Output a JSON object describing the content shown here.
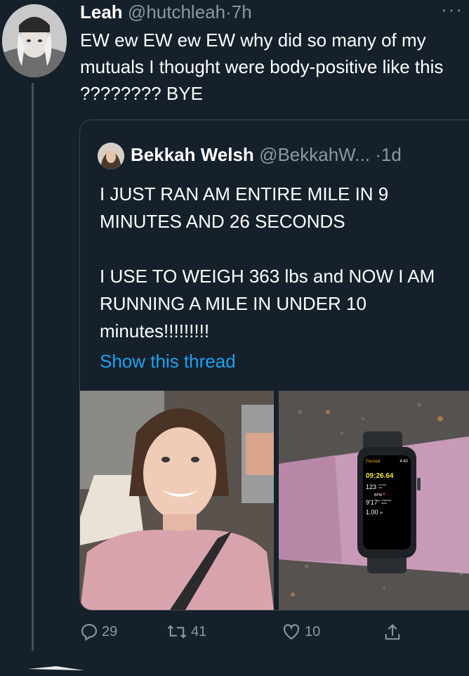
{
  "tweet": {
    "author_name": "Leah",
    "handle": "@hutchleah",
    "separator": "·",
    "time": "7h",
    "text": "EW ew EW ew EW why did so many of my mutuals I thought were body-positive like this ???????? BYE"
  },
  "quote": {
    "author_name": "Bekkah Welsh",
    "handle": "@BekkahW...",
    "separator": "·",
    "time": "1d",
    "text": "I JUST RAN AM ENTIRE MILE IN 9 MINUTES AND 26 SECONDS\n\nI USE TO WEIGH 363 lbs and NOW I AM RUNNING A MILE IN UNDER 10 minutes!!!!!!!!!",
    "show_thread": "Show this thread",
    "watch": {
      "status": "Paused",
      "clock": "4:40",
      "elapsed": "09:26.64",
      "calories": "123",
      "calories_unit": "ACTIVE CAL",
      "heart_label": "BPM",
      "pace": "9'17\"",
      "pace_unit": "AVERAGE PACE",
      "distance": "1.00",
      "distance_unit": "MI"
    }
  },
  "actions": {
    "replies": "29",
    "retweets": "41",
    "likes": "10"
  },
  "colors": {
    "background": "#15202b",
    "secondary_text": "#8899a6",
    "link": "#1da1f2",
    "border": "#38444d"
  },
  "icons": [
    "more-icon",
    "reply-icon",
    "retweet-icon",
    "like-icon",
    "share-icon"
  ]
}
